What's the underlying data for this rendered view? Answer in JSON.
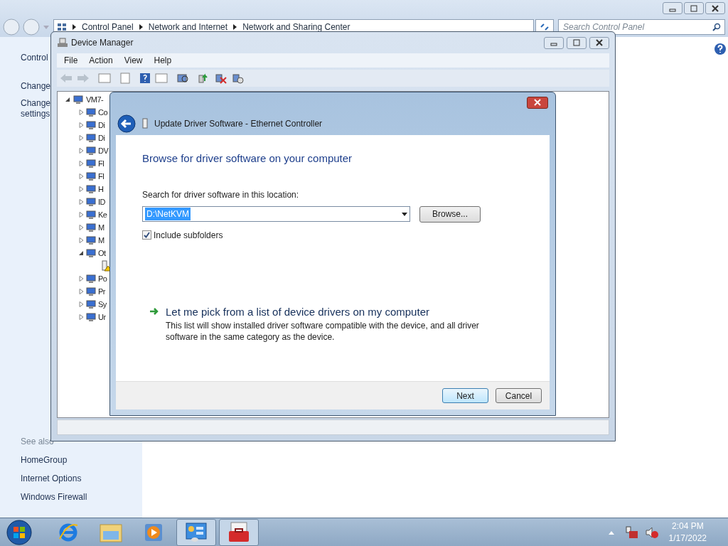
{
  "control_panel": {
    "breadcrumbs": [
      "Control Panel",
      "Network and Internet",
      "Network and Sharing Center"
    ],
    "search": {
      "placeholder": "Search Control Panel"
    },
    "sidebar": {
      "items": [
        "Control",
        "Change",
        "Change settings"
      ]
    },
    "see_also": {
      "title": "See also",
      "links": [
        "HomeGroup",
        "Internet Options",
        "Windows Firewall"
      ]
    }
  },
  "device_manager": {
    "title": "Device Manager",
    "menu": [
      "File",
      "Action",
      "View",
      "Help"
    ],
    "tree": {
      "label": "VM7-",
      "expanded": true,
      "children": [
        {
          "label": "Co",
          "expanded": false
        },
        {
          "label": "Di",
          "expanded": false
        },
        {
          "label": "Di",
          "expanded": false
        },
        {
          "label": "DV",
          "expanded": false
        },
        {
          "label": "Fl",
          "expanded": false
        },
        {
          "label": "Fl",
          "expanded": false
        },
        {
          "label": "H",
          "expanded": false
        },
        {
          "label": "ID",
          "expanded": false
        },
        {
          "label": "Ke",
          "expanded": false
        },
        {
          "label": "M",
          "expanded": false
        },
        {
          "label": "M",
          "expanded": false
        },
        {
          "label": "Ot",
          "expanded": true,
          "children": [
            {
              "warning": true
            }
          ]
        },
        {
          "label": "Po",
          "expanded": false
        },
        {
          "label": "Pr",
          "expanded": false
        },
        {
          "label": "Sy",
          "expanded": false
        },
        {
          "label": "Ur",
          "expanded": false
        }
      ]
    }
  },
  "dialog": {
    "title": "Update Driver Software - Ethernet Controller",
    "heading": "Browse for driver software on your computer",
    "location_label": "Search for driver software in this location:",
    "location": {
      "value": "D:\\NetKVM"
    },
    "browse": "Browse...",
    "include_subfolders": {
      "label": "Include subfolders",
      "checked": true
    },
    "pick_link": {
      "label": "Let me pick from a list of device drivers on my computer",
      "description": "This list will show installed driver software compatible with the device, and all driver software in the same category as the device."
    },
    "buttons": [
      {
        "label": "Next",
        "default": true
      },
      {
        "label": "Cancel",
        "default": false
      }
    ]
  },
  "taskbar": {
    "apps": [
      {
        "kind": "browser",
        "open": false
      },
      {
        "kind": "folder",
        "open": false
      },
      {
        "kind": "media",
        "open": false
      },
      {
        "kind": "control",
        "open": true
      },
      {
        "kind": "toolbox",
        "open": true
      }
    ],
    "clock": {
      "time": "2:04 PM",
      "date": "1/17/2022"
    }
  }
}
